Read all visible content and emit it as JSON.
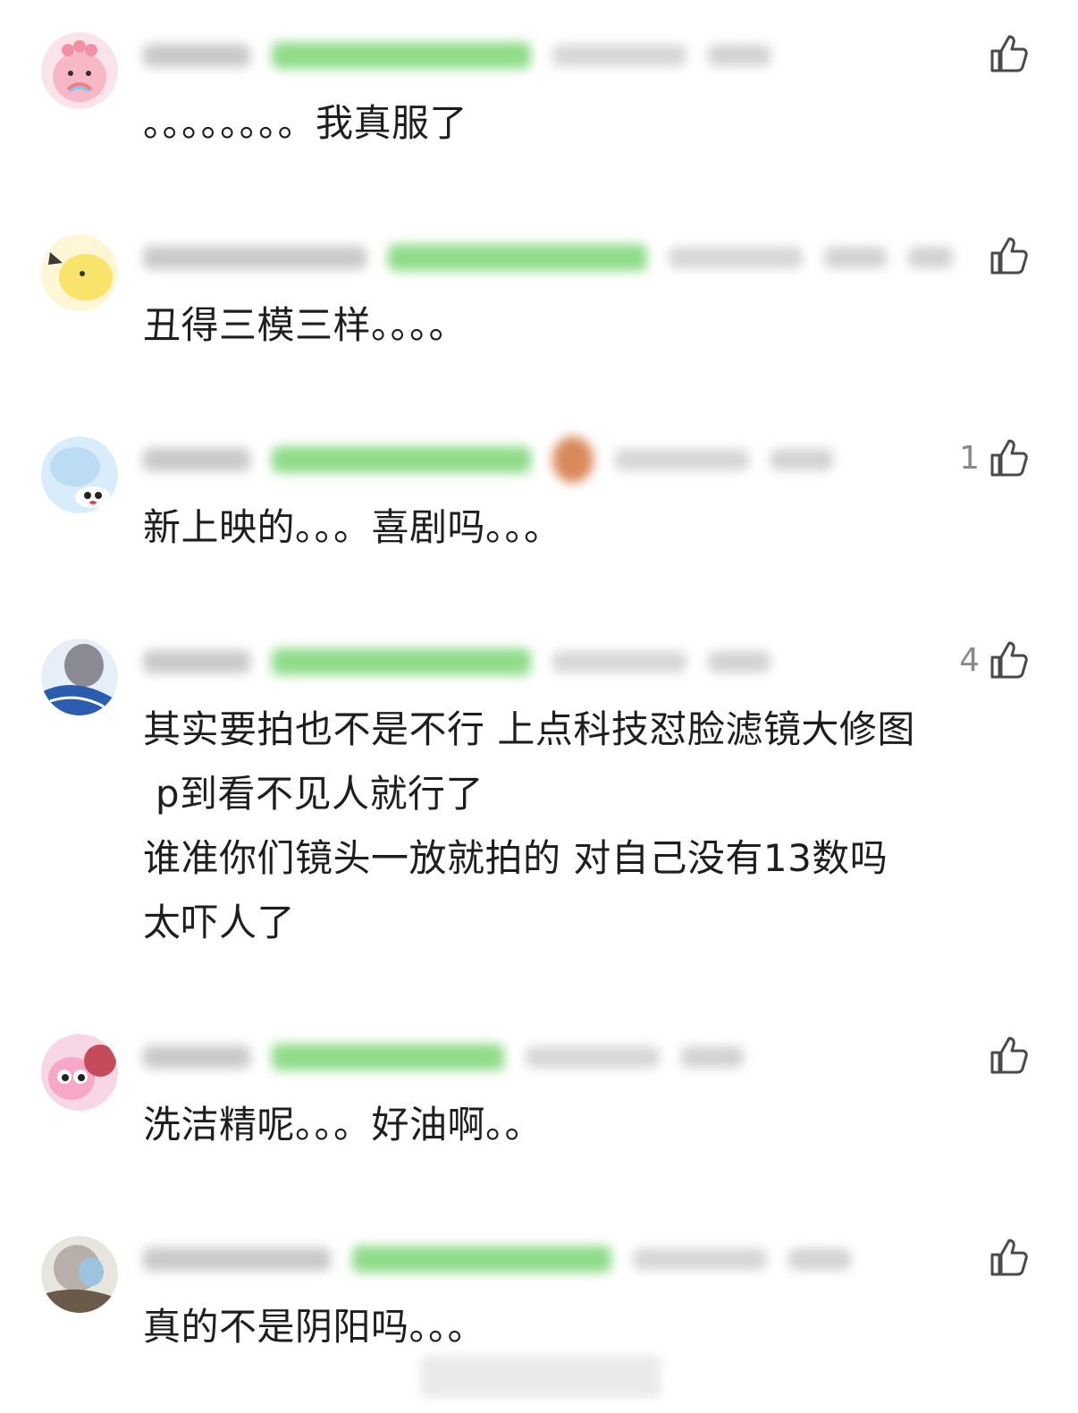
{
  "comments": [
    {
      "text": "。。。。。。。。我真服了",
      "likes": ""
    },
    {
      "text": "丑得三模三样。。。。",
      "likes": ""
    },
    {
      "text": "新上映的。。。喜剧吗。。。",
      "likes": "1"
    },
    {
      "text": "其实要拍也不是不行 上点科技怼脸滤镜大修图\n p到看不见人就行了\n谁准你们镜头一放就拍的 对自己没有13数吗\n太吓人了",
      "likes": "4"
    },
    {
      "text": "洗洁精呢。。。好油啊。。",
      "likes": ""
    },
    {
      "text": "真的不是阴阳吗。。。",
      "likes": ""
    }
  ],
  "icons": {
    "like": "thumbs-up-icon"
  }
}
